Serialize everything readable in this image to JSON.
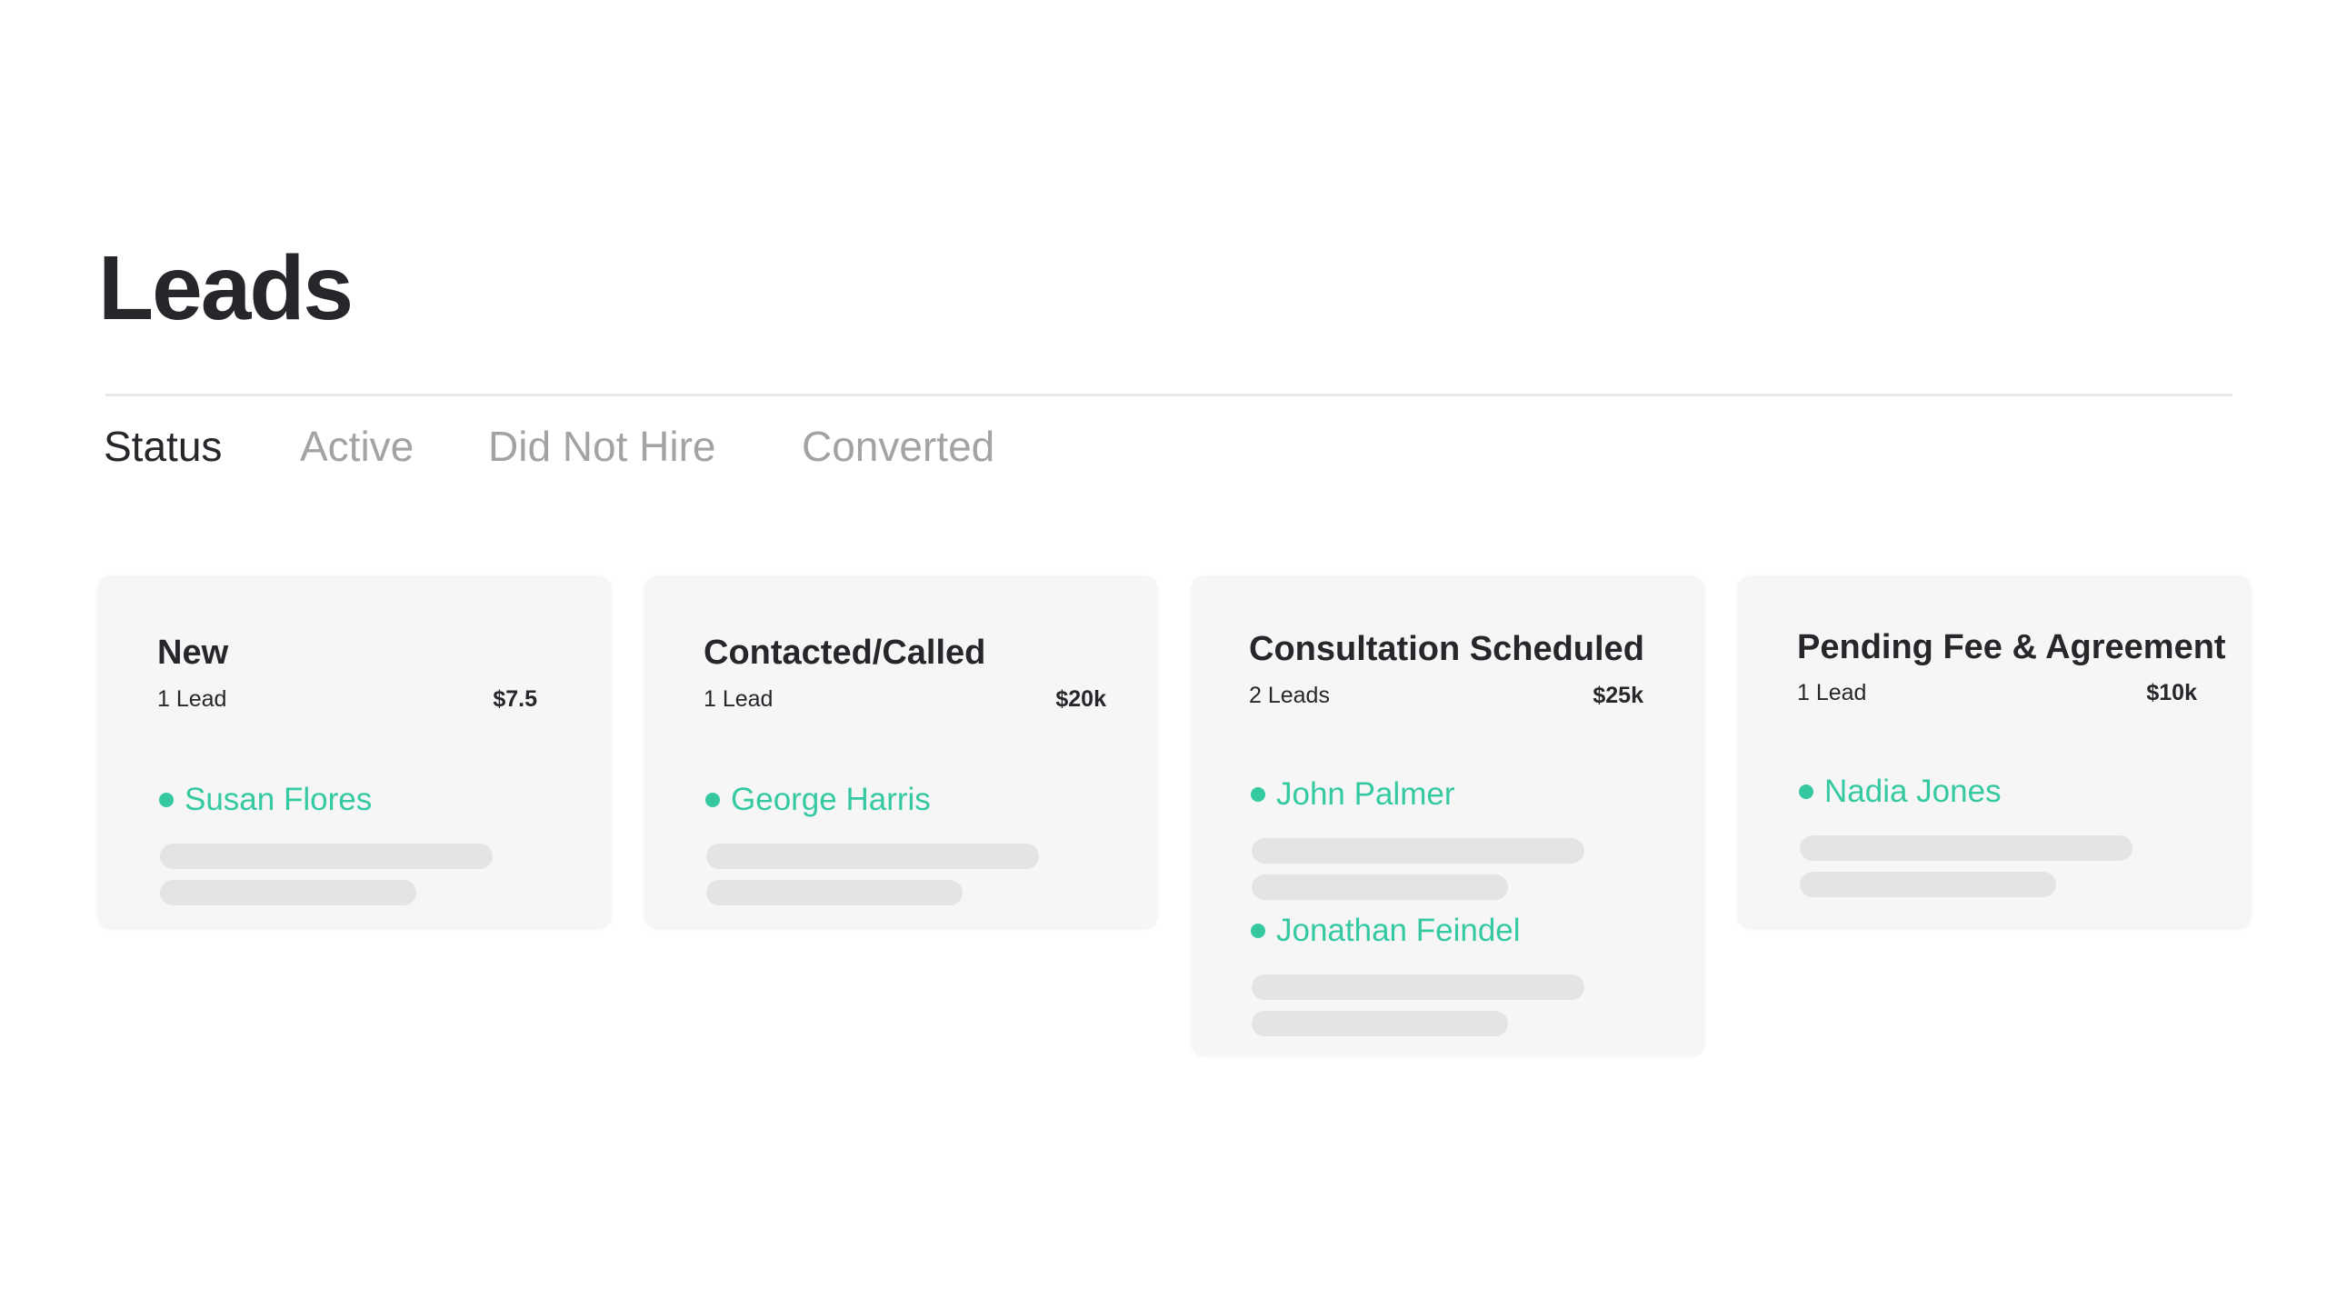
{
  "page": {
    "title": "Leads"
  },
  "tabs": [
    {
      "label": "Status",
      "active": true
    },
    {
      "label": "Active",
      "active": false
    },
    {
      "label": "Did Not Hire",
      "active": false
    },
    {
      "label": "Converted",
      "active": false
    }
  ],
  "columns": [
    {
      "title": "New",
      "count": "1 Lead",
      "amount": "$7.5",
      "leads": [
        {
          "name": "Susan Flores"
        }
      ]
    },
    {
      "title": "Contacted/Called",
      "count": "1 Lead",
      "amount": "$20k",
      "leads": [
        {
          "name": "George Harris"
        }
      ]
    },
    {
      "title": "Consultation Scheduled",
      "count": "2 Leads",
      "amount": "$25k",
      "leads": [
        {
          "name": "John Palmer"
        },
        {
          "name": "Jonathan Feindel"
        }
      ]
    },
    {
      "title": "Pending Fee & Agreement",
      "count": "1 Lead",
      "amount": "$10k",
      "leads": [
        {
          "name": "Nadia Jones"
        }
      ]
    }
  ],
  "colors": {
    "accent": "#34c9a0",
    "text": "#26262b",
    "muted": "#a3a3a3",
    "card": "#f6f6f6",
    "placeholder": "#e4e4e4"
  },
  "icons": {
    "lead_status": "dot-icon"
  }
}
